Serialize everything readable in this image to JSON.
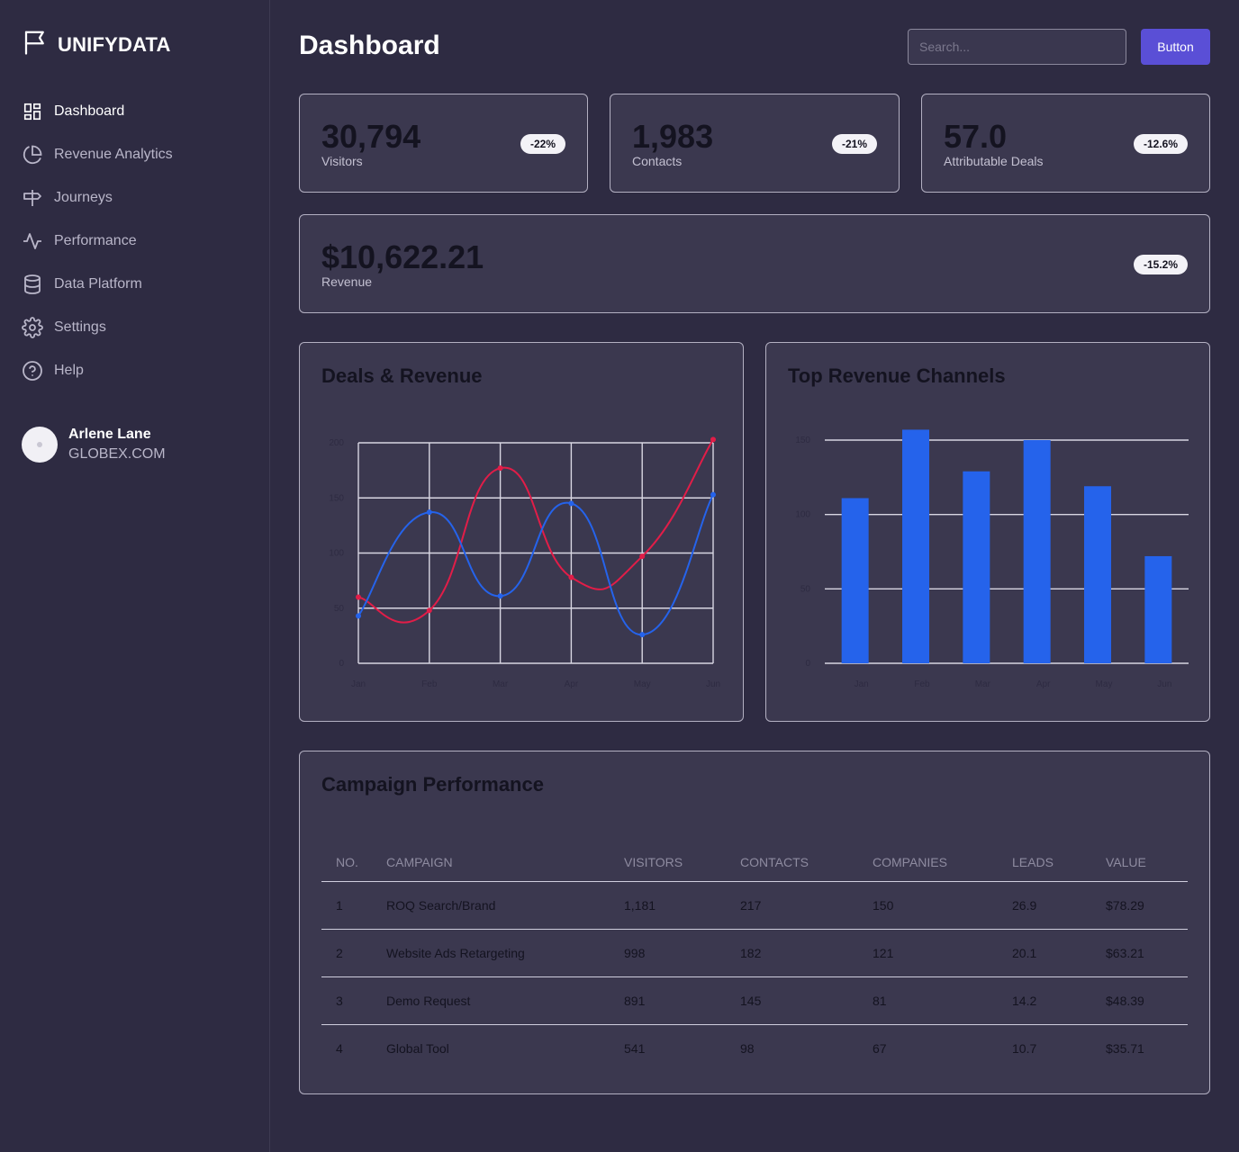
{
  "brand": {
    "name": "UNIFYDATA",
    "icon": "flag-icon"
  },
  "sidebar": {
    "items": [
      {
        "label": "Dashboard",
        "icon": "dashboard-grid-icon",
        "active": true
      },
      {
        "label": "Revenue Analytics",
        "icon": "pie-chart-icon",
        "active": false
      },
      {
        "label": "Journeys",
        "icon": "signpost-icon",
        "active": false
      },
      {
        "label": "Performance",
        "icon": "activity-icon",
        "active": false
      },
      {
        "label": "Data Platform",
        "icon": "database-icon",
        "active": false
      },
      {
        "label": "Settings",
        "icon": "gear-icon",
        "active": false
      },
      {
        "label": "Help",
        "icon": "help-circle-icon",
        "active": false
      }
    ]
  },
  "user": {
    "name": "Arlene Lane",
    "org": "GLOBEX.COM"
  },
  "header": {
    "title": "Dashboard",
    "search_placeholder": "Search...",
    "button_label": "Button"
  },
  "stats": [
    {
      "value": "30,794",
      "label": "Visitors",
      "change": "-22%"
    },
    {
      "value": "1,983",
      "label": "Contacts",
      "change": "-21%"
    },
    {
      "value": "57.0",
      "label": "Attributable Deals",
      "change": "-12.6%"
    },
    {
      "value": "$10,622.21",
      "label": "Revenue",
      "change": "-15.2%"
    }
  ],
  "colors": {
    "accent": "#5a4fd6",
    "line_red": "#e11d48",
    "line_blue": "#2563eb",
    "bar_blue": "#2563eb"
  },
  "chart_data": [
    {
      "type": "line",
      "title": "Deals & Revenue",
      "categories": [
        "Jan",
        "Feb",
        "Mar",
        "Apr",
        "May",
        "Jun"
      ],
      "series": [
        {
          "values": [
            60,
            48,
            177,
            78,
            97,
            203
          ],
          "color": "#e11d48"
        },
        {
          "values": [
            43,
            137,
            61,
            145,
            26,
            153
          ],
          "color": "#2563eb"
        }
      ],
      "yticks": [
        0,
        50,
        100,
        150,
        200
      ],
      "ylim": [
        0,
        200
      ],
      "grid": true
    },
    {
      "type": "bar",
      "title": "Top Revenue Channels",
      "categories": [
        "Jan",
        "Feb",
        "Mar",
        "Apr",
        "May",
        "Jun"
      ],
      "values": [
        111,
        157,
        129,
        150,
        119,
        72
      ],
      "yticks": [
        0,
        50,
        100,
        150
      ],
      "ylim": [
        0,
        150
      ],
      "grid": true
    }
  ],
  "table": {
    "title": "Campaign Performance",
    "headers": [
      "NO.",
      "CAMPAIGN",
      "VISITORS",
      "CONTACTS",
      "COMPANIES",
      "LEADS",
      "VALUE"
    ],
    "rows": [
      [
        "1",
        "ROQ Search/Brand",
        "1,181",
        "217",
        "150",
        "26.9",
        "$78.29"
      ],
      [
        "2",
        "Website Ads Retargeting",
        "998",
        "182",
        "121",
        "20.1",
        "$63.21"
      ],
      [
        "3",
        "Demo Request",
        "891",
        "145",
        "81",
        "14.2",
        "$48.39"
      ],
      [
        "4",
        "Global Tool",
        "541",
        "98",
        "67",
        "10.7",
        "$35.71"
      ]
    ]
  }
}
